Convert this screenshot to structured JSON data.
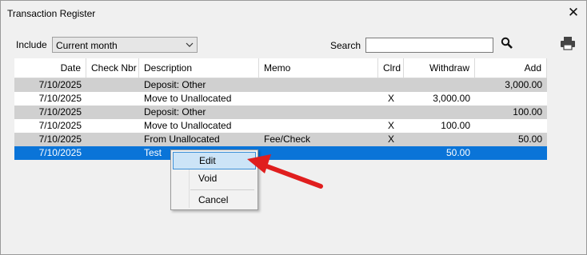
{
  "window": {
    "title": "Transaction Register"
  },
  "filters": {
    "include_label": "Include",
    "include_value": "Current month",
    "search_label": "Search",
    "search_value": ""
  },
  "table": {
    "headers": {
      "date": "Date",
      "check": "Check Nbr",
      "description": "Description",
      "memo": "Memo",
      "clrd": "Clrd",
      "withdraw": "Withdraw",
      "add": "Add"
    },
    "rows": [
      {
        "date": "7/10/2025",
        "check": "",
        "description": "Deposit: Other",
        "memo": "",
        "clrd": "",
        "withdraw": "",
        "add": "3,000.00"
      },
      {
        "date": "7/10/2025",
        "check": "",
        "description": "Move to Unallocated",
        "memo": "",
        "clrd": "X",
        "withdraw": "3,000.00",
        "add": ""
      },
      {
        "date": "7/10/2025",
        "check": "",
        "description": "Deposit: Other",
        "memo": "",
        "clrd": "",
        "withdraw": "",
        "add": "100.00"
      },
      {
        "date": "7/10/2025",
        "check": "",
        "description": "Move to Unallocated",
        "memo": "",
        "clrd": "X",
        "withdraw": "100.00",
        "add": ""
      },
      {
        "date": "7/10/2025",
        "check": "",
        "description": "From Unallocated",
        "memo": "Fee/Check",
        "clrd": "X",
        "withdraw": "",
        "add": "50.00"
      },
      {
        "date": "7/10/2025",
        "check": "",
        "description": "Test",
        "memo": "",
        "clrd": "",
        "withdraw": "50.00",
        "add": ""
      }
    ]
  },
  "context_menu": {
    "items": [
      "Edit",
      "Void",
      "Cancel"
    ]
  },
  "icons": {
    "close": "close-icon",
    "search": "search-icon",
    "print": "printer-icon",
    "annotation": "red-arrow"
  },
  "colors": {
    "selection": "#0a74d8",
    "alt_row": "#d0d0d0",
    "menu_highlight": "#cce4f7",
    "arrow": "#e01e1e"
  }
}
